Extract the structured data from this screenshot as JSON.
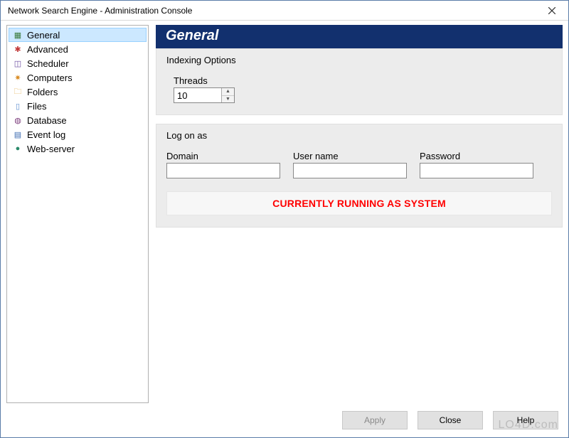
{
  "window": {
    "title": "Network Search Engine - Administration Console"
  },
  "sidebar": {
    "items": [
      {
        "label": "General",
        "icon": "general",
        "color": "#3a7a3a"
      },
      {
        "label": "Advanced",
        "icon": "advanced",
        "color": "#c23a3a"
      },
      {
        "label": "Scheduler",
        "icon": "scheduler",
        "color": "#6a4aa0"
      },
      {
        "label": "Computers",
        "icon": "computers",
        "color": "#d98a20"
      },
      {
        "label": "Folders",
        "icon": "folders",
        "color": "#e0a030"
      },
      {
        "label": "Files",
        "icon": "files",
        "color": "#6090d0"
      },
      {
        "label": "Database",
        "icon": "database",
        "color": "#7a3a7a"
      },
      {
        "label": "Event log",
        "icon": "eventlog",
        "color": "#3a6ab0"
      },
      {
        "label": "Web-server",
        "icon": "webserver",
        "color": "#2a8a6a"
      }
    ],
    "selected_index": 0
  },
  "header": {
    "title": "General"
  },
  "indexing": {
    "group_title": "Indexing Options",
    "threads_label": "Threads",
    "threads_value": "10"
  },
  "logon": {
    "group_title": "Log on as",
    "domain_label": "Domain",
    "domain_value": "",
    "username_label": "User name",
    "username_value": "",
    "password_label": "Password",
    "password_value": "",
    "status_text": "CURRENTLY RUNNING AS SYSTEM"
  },
  "footer": {
    "apply_label": "Apply",
    "close_label": "Close",
    "help_label": "Help"
  },
  "watermark": "LO4D.com"
}
